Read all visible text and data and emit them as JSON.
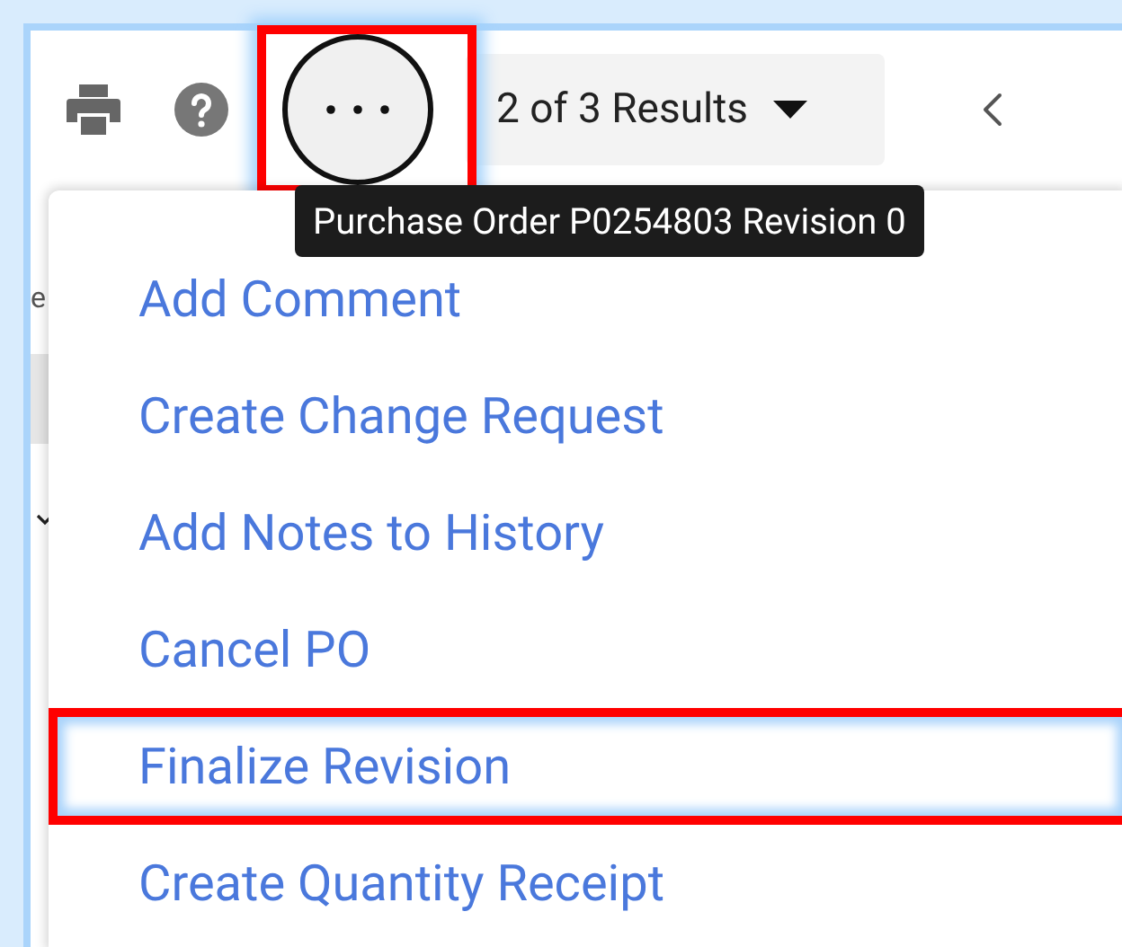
{
  "toolbar": {
    "results_label": "2 of 3 Results",
    "more_button": {
      "highlighted": true
    }
  },
  "tooltip": "Purchase Order P0254803 Revision 0",
  "background_fragment": "e",
  "menu": {
    "items": [
      {
        "label": "Add Comment",
        "highlighted": false
      },
      {
        "label": "Create Change Request",
        "highlighted": false
      },
      {
        "label": "Add Notes to History",
        "highlighted": false
      },
      {
        "label": "Cancel PO",
        "highlighted": false
      },
      {
        "label": "Finalize Revision",
        "highlighted": true
      },
      {
        "label": "Create Quantity Receipt",
        "highlighted": false
      }
    ]
  }
}
